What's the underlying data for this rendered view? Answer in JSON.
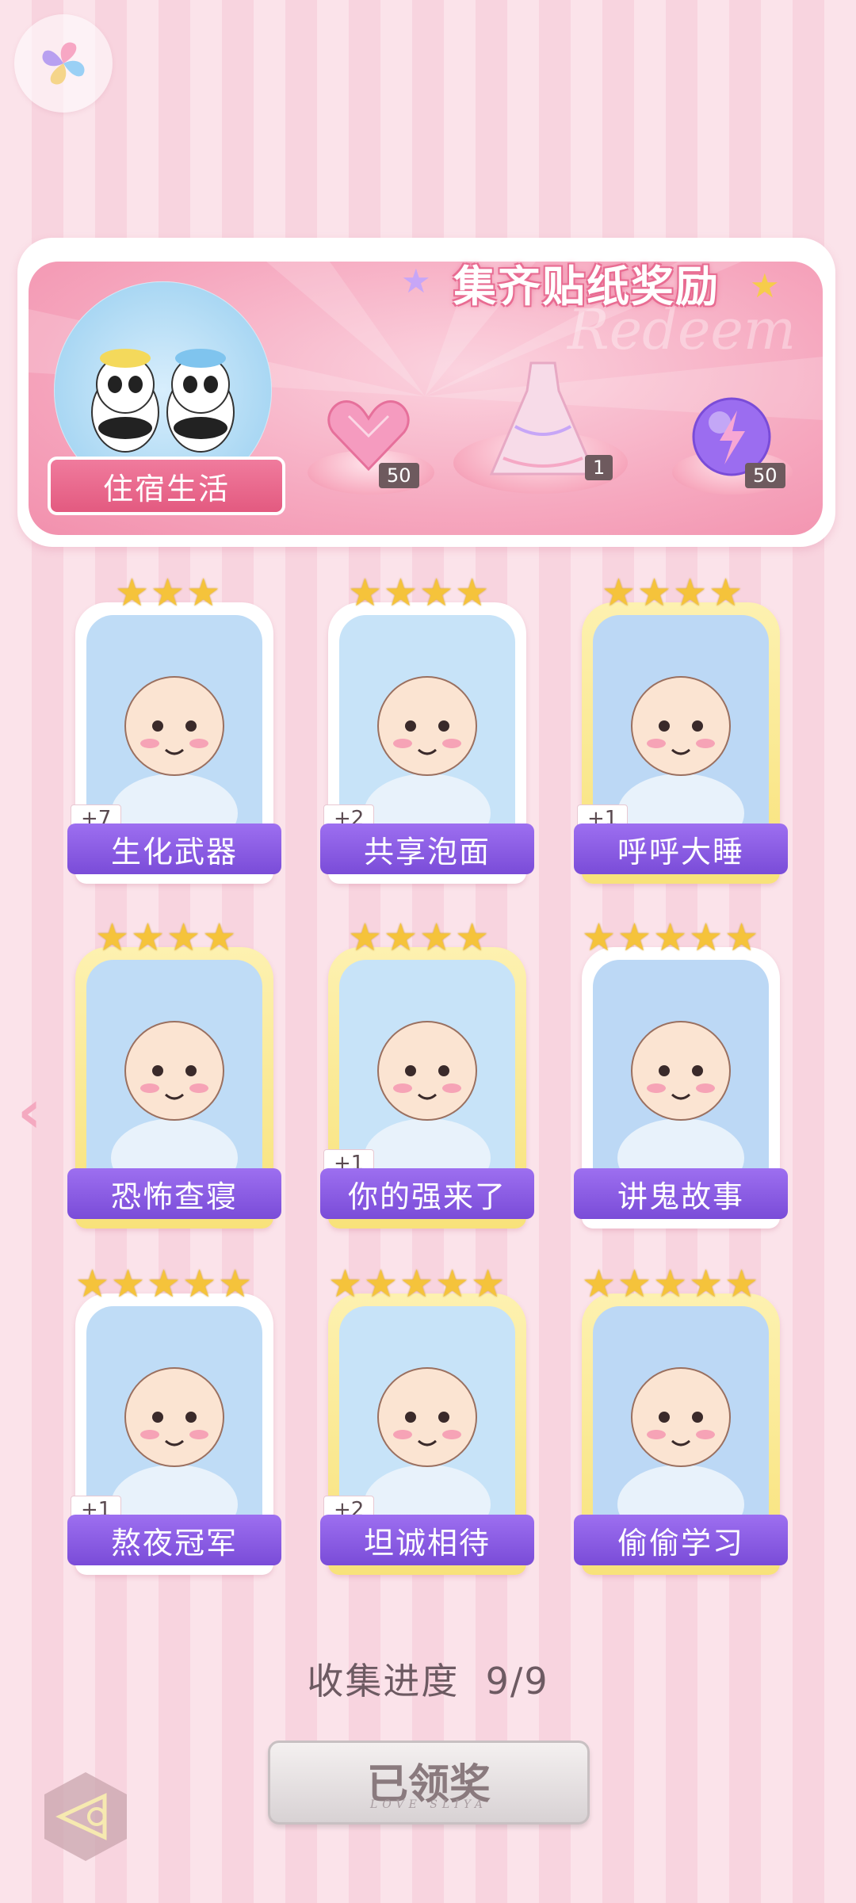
{
  "banner": {
    "title": "集齐贴纸奖励",
    "theme_label": "住宿生活",
    "rewards": [
      {
        "name": "heart-gem",
        "count": "50"
      },
      {
        "name": "dress",
        "count": "1"
      },
      {
        "name": "energy-orb",
        "count": "50"
      }
    ]
  },
  "stickers": [
    {
      "label": "生化武器",
      "count": "+7",
      "stars": 3
    },
    {
      "label": "共享泡面",
      "count": "+2",
      "stars": 4
    },
    {
      "label": "呼呼大睡",
      "count": "+1",
      "stars": 4
    },
    {
      "label": "恐怖查寝",
      "count": "",
      "stars": 4
    },
    {
      "label": "你的强来了",
      "count": "+1",
      "stars": 4
    },
    {
      "label": "讲鬼故事",
      "count": "",
      "stars": 5
    },
    {
      "label": "熬夜冠军",
      "count": "+1",
      "stars": 5
    },
    {
      "label": "坦诚相待",
      "count": "+2",
      "stars": 5
    },
    {
      "label": "偷偷学习",
      "count": "",
      "stars": 5
    }
  ],
  "progress": {
    "label": "收集进度",
    "value": "9/9"
  },
  "claim_button": {
    "label": "已领奖",
    "sub": "LOVE SLIYA"
  },
  "colors": {
    "accent": "#8a5be0",
    "pink": "#f290ad",
    "gold": "#f5c33b"
  }
}
